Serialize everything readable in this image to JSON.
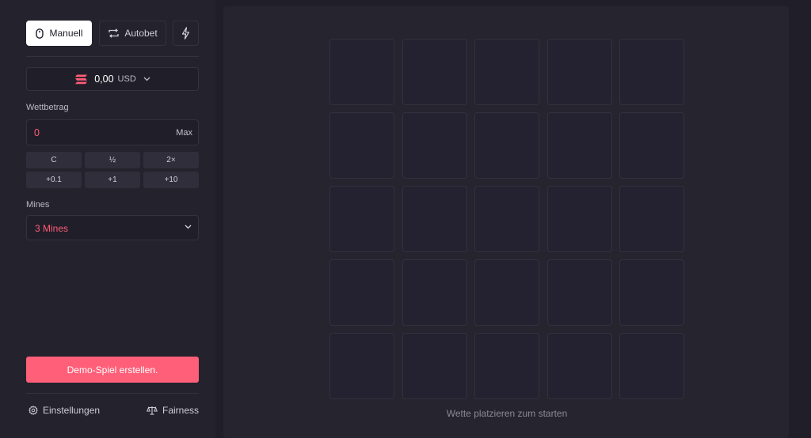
{
  "mode_tabs": {
    "manual_label": "Manuell",
    "autobet_label": "Autobet"
  },
  "currency": {
    "amount": "0,00",
    "code": "USD",
    "coin_color": "#ff5c78"
  },
  "bet": {
    "label": "Wettbetrag",
    "value": "0",
    "max_label": "Max",
    "quick_buttons": [
      "C",
      "½",
      "2×",
      "+0.1",
      "+1",
      "+10"
    ]
  },
  "mines": {
    "label": "Mines",
    "selected": "3 Mines"
  },
  "create_button": "Demo-Spiel erstellen.",
  "footer": {
    "settings_label": "Einstellungen",
    "fairness_label": "Fairness"
  },
  "board": {
    "rows": 5,
    "cols": 5,
    "hint": "Wette platzieren zum starten"
  },
  "colors": {
    "accent": "#ff5f78",
    "background": "#201e29",
    "panel": "#24222d"
  }
}
